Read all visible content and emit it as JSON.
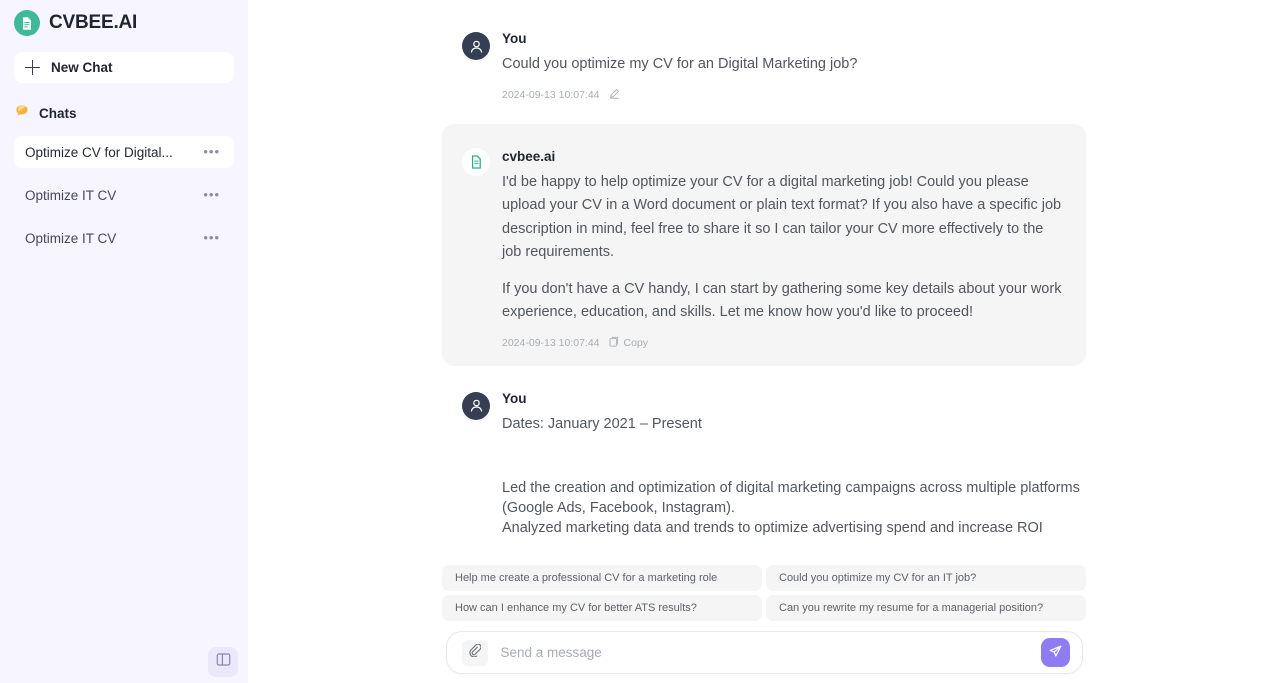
{
  "brand": {
    "name": "CVBEE.AI",
    "logo_icon": "document-icon",
    "logo_color": "#3fb998"
  },
  "sidebar": {
    "new_chat_label": "New Chat",
    "new_chat_icon": "plus-icon",
    "chats_section_label": "Chats",
    "chats_section_icon": "speech-bubble-icon",
    "chat_items": [
      {
        "label": "Optimize CV for Digital...",
        "menu_icon": "ellipsis-icon",
        "active": true
      },
      {
        "label": "Optimize IT CV",
        "menu_icon": "ellipsis-icon",
        "active": false
      },
      {
        "label": "Optimize IT CV",
        "menu_icon": "ellipsis-icon",
        "active": false
      }
    ],
    "toggle_icon": "sidebar-panel-icon",
    "background_color": "#f7f5ff"
  },
  "conversation": {
    "messages": [
      {
        "role": "user",
        "sender": "You",
        "avatar_icon": "user-avatar-icon",
        "text": "Could you optimize my CV for an Digital Marketing  job?",
        "timestamp": "2024-09-13 10:07:44",
        "action_label": "",
        "action_icon": "pencil-edit-icon"
      },
      {
        "role": "assistant",
        "sender": "cvbee.ai",
        "avatar_icon": "document-icon",
        "paragraph_1": "I'd be happy to help optimize your CV for a digital marketing job! Could you please upload your CV in a Word document or plain text format? If you also have a specific job description in mind, feel free to share it so I can tailor your CV more effectively to the job requirements.",
        "paragraph_2": "If you don't have a CV handy, I can start by gathering some key details about your work experience, education, and skills. Let me know how you'd like to proceed!",
        "timestamp": "2024-09-13 10:07:44",
        "action_label": "Copy",
        "action_icon": "copy-icon"
      },
      {
        "role": "user",
        "sender": "You",
        "avatar_icon": "user-avatar-icon",
        "text": "Dates: January 2021 – Present",
        "continuation": "Led the creation and optimization of digital marketing campaigns across multiple platforms (Google Ads, Facebook, Instagram).\nAnalyzed marketing data and trends to optimize advertising spend and increase ROI"
      }
    ]
  },
  "suggestions": [
    "Help me create a professional CV for a marketing role",
    "Could you optimize my CV for an IT job?",
    "How can I enhance my CV for better ATS results?",
    "Can you rewrite my resume for a managerial position?"
  ],
  "composer": {
    "placeholder": "Send a message",
    "value": "",
    "attach_icon": "paperclip-icon",
    "send_icon": "paper-plane-icon",
    "send_color": "#8f7cf2"
  }
}
